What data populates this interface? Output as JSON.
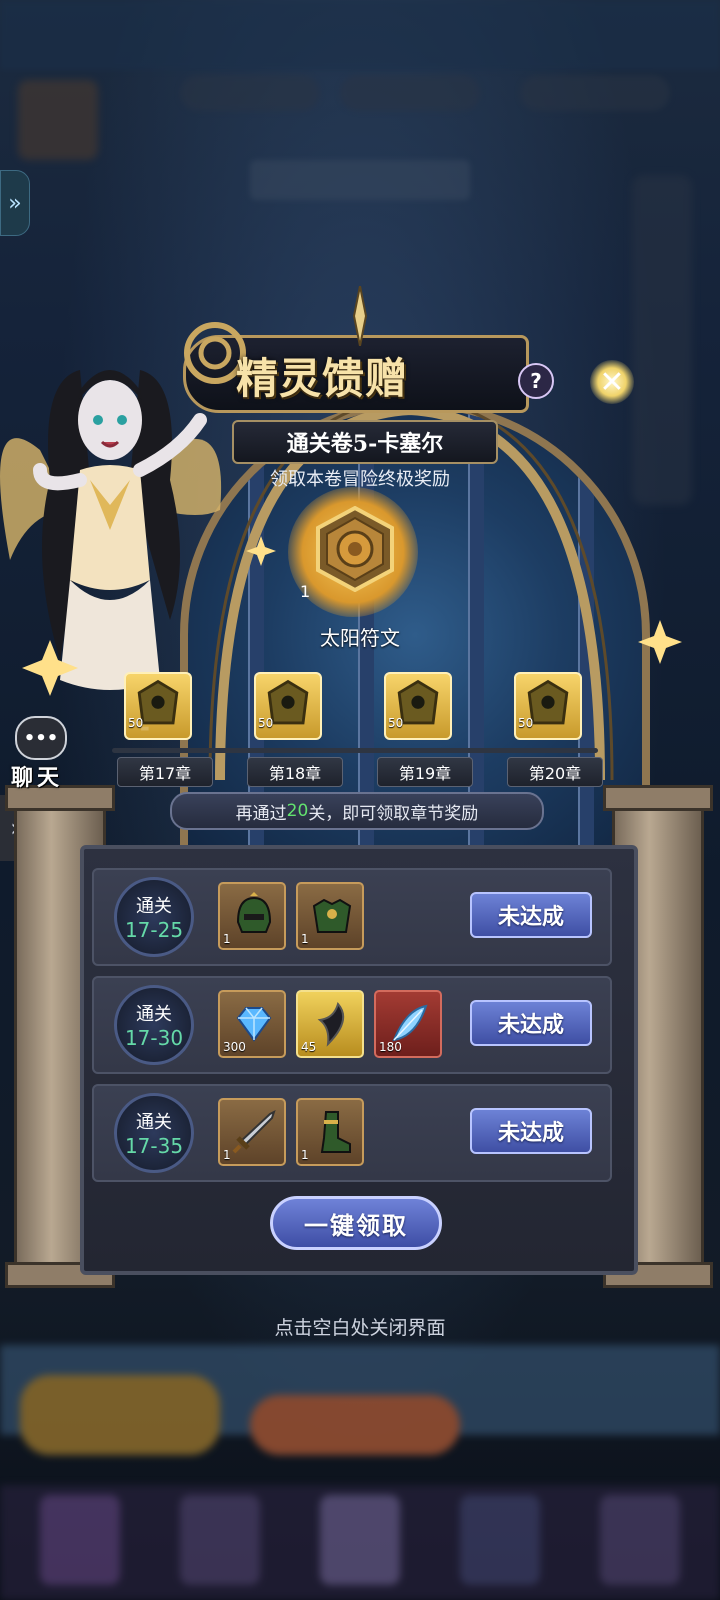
{
  "title": "精灵馈赠",
  "subtitle": "通关卷5-卡塞尔",
  "description": "领取本卷冒险终极奖励",
  "grand_reward": {
    "name": "太阳符文",
    "quantity": "1"
  },
  "chapters": [
    {
      "label": "第17章",
      "count": "50"
    },
    {
      "label": "第18章",
      "count": "50"
    },
    {
      "label": "第19章",
      "count": "50"
    },
    {
      "label": "第20章",
      "count": "50"
    }
  ],
  "tip": {
    "prefix": "再通过",
    "highlight": "20",
    "suffix": "关，即可领取章节奖励"
  },
  "rows": [
    {
      "stage_title": "通关",
      "stage": "17-25",
      "items": [
        {
          "icon": "helmet-icon",
          "qty": "1",
          "style": "brown"
        },
        {
          "icon": "armor-icon",
          "qty": "1",
          "style": "brown"
        }
      ],
      "status": "未达成"
    },
    {
      "stage_title": "通关",
      "stage": "17-30",
      "items": [
        {
          "icon": "diamond-icon",
          "qty": "300",
          "style": "brown"
        },
        {
          "icon": "claw-icon",
          "qty": "45",
          "style": "gold"
        },
        {
          "icon": "feather-icon",
          "qty": "180",
          "style": "red"
        }
      ],
      "status": "未达成"
    },
    {
      "stage_title": "通关",
      "stage": "17-35",
      "items": [
        {
          "icon": "sword-icon",
          "qty": "1",
          "style": "brown"
        },
        {
          "icon": "boots-icon",
          "qty": "1",
          "style": "brown"
        }
      ],
      "status": "未达成"
    }
  ],
  "claim_all_label": "一键领取",
  "close_hint": "点击空白处关闭界面",
  "chat_label": "聊天",
  "chat_icon": "speech-bubble-icon",
  "colors": {
    "accent_green": "#63e36f",
    "stage_green": "#65d9a8",
    "button_blue": "#4f63c0",
    "gold": "#f7e2a9"
  }
}
